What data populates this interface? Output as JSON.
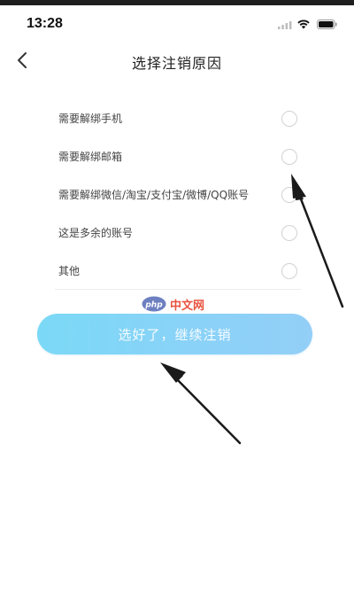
{
  "status_bar": {
    "time": "13:28"
  },
  "nav": {
    "title": "选择注销原因"
  },
  "options": [
    {
      "label": "需要解绑手机",
      "selected": false
    },
    {
      "label": "需要解绑邮箱",
      "selected": false
    },
    {
      "label": "需要解绑微信/淘宝/支付宝/微博/QQ账号",
      "selected": false
    },
    {
      "label": "这是多余的账号",
      "selected": false
    },
    {
      "label": "其他",
      "selected": false
    }
  ],
  "watermark": {
    "logo_text": "php",
    "text": "中文网"
  },
  "continue_button": {
    "label": "选好了，继续注销"
  },
  "colors": {
    "button_start": "#7ad9f6",
    "button_end": "#93cff7",
    "watermark_text": "#e8533f",
    "watermark_logo": "#6c7fc0"
  }
}
